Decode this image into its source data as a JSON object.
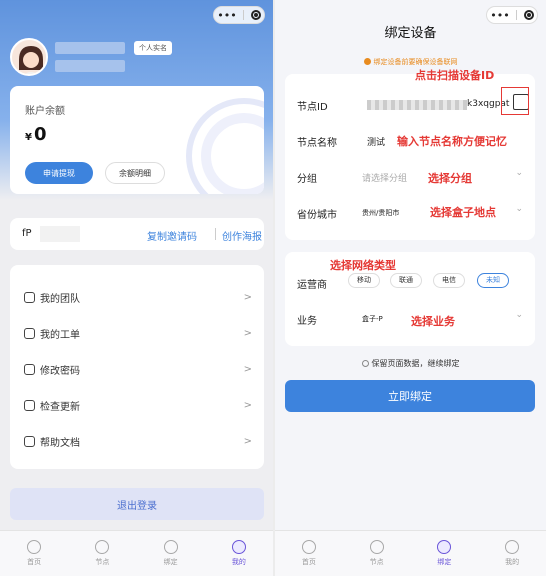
{
  "left": {
    "header": {
      "tag_real_name": "个人实名"
    },
    "balance": {
      "title": "账户余额",
      "currency": "¥",
      "value": "0",
      "withdraw_label": "申请提现",
      "detail_label": "余额明细"
    },
    "invite": {
      "code_prefix": "fP",
      "copy_label": "复制邀请码",
      "poster_label": "创作海报"
    },
    "menu": [
      {
        "label": "我的团队",
        "icon": "team-icon"
      },
      {
        "label": "我的工单",
        "icon": "ticket-icon"
      },
      {
        "label": "修改密码",
        "icon": "password-icon"
      },
      {
        "label": "检查更新",
        "icon": "update-icon"
      },
      {
        "label": "帮助文档",
        "icon": "help-icon"
      }
    ],
    "menu_arrow": ">",
    "logout_label": "退出登录",
    "tabs": [
      "首页",
      "节点",
      "绑定",
      "我的"
    ],
    "active_tab": "我的"
  },
  "right": {
    "title": "绑定设备",
    "tip": "绑定设备前要确保设备联网",
    "form": {
      "node_id_label": "节点ID",
      "node_id_suffix": "k3xqgpat",
      "node_name_label": "节点名称",
      "node_name_value": "测试",
      "group_label": "分组",
      "group_placeholder": "请选择分组",
      "region_label": "省份城市",
      "region_value": "贵州/贵阳市",
      "operator_label": "运营商",
      "operators": [
        "移动",
        "联通",
        "电信",
        "未知"
      ],
      "selected_operator": "未知",
      "business_label": "业务",
      "business_value": "盒子-P",
      "chevron": "⌄"
    },
    "keep_label": "保留页面数据，继续绑定",
    "bind_label": "立即绑定",
    "tabs": [
      "首页",
      "节点",
      "绑定",
      "我的"
    ],
    "active_tab": "绑定"
  },
  "annotations": {
    "scan": "点击扫描设备ID",
    "name": "输入节点名称方便记忆",
    "group": "选择分组",
    "region": "选择盒子地点",
    "network": "选择网络类型",
    "business": "选择业务"
  },
  "colors": {
    "primary": "#3d83dd",
    "accent_purple": "#6a55d8",
    "warning": "#e88b1f",
    "annotation": "#e53935"
  }
}
